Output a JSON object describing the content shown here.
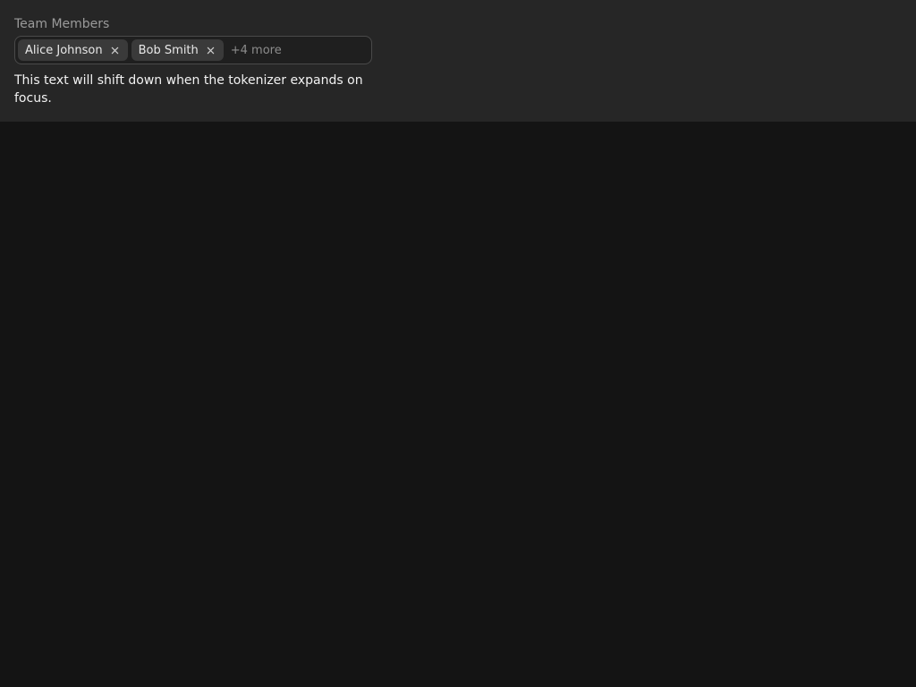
{
  "field": {
    "label": "Team Members"
  },
  "tokenizer": {
    "tokens": [
      {
        "label": "Alice Johnson",
        "remove_icon": "close-icon"
      },
      {
        "label": "Bob Smith",
        "remove_icon": "close-icon"
      }
    ],
    "more_label": "+4 more",
    "input_value": "",
    "input_placeholder": ""
  },
  "helper": {
    "text": "This text will shift down when the tokenizer expands on focus."
  },
  "colors": {
    "page_background": "#141414",
    "panel_background": "#262626",
    "token_background": "#3a3a3a",
    "label_text": "#9a9a9a",
    "body_text": "#f2f2f2"
  }
}
